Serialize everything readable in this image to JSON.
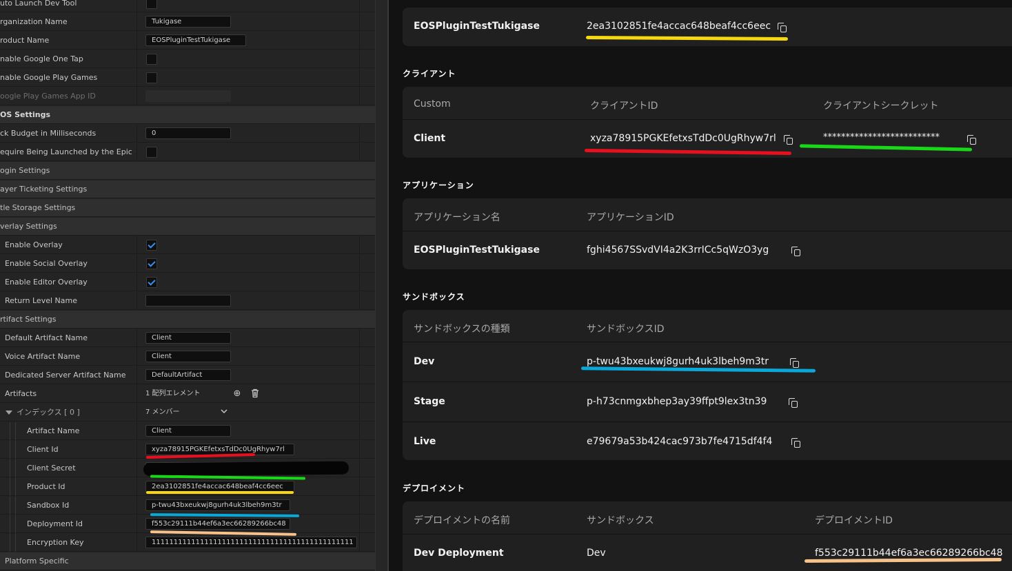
{
  "colors": {
    "red": "#e8101e",
    "green": "#18d818",
    "yellow": "#f6d80e",
    "blue": "#0aa8d8",
    "orange": "#f7c28a"
  },
  "ue": {
    "rows": [
      {
        "label": "uto Launch Dev Tool"
      },
      {
        "label": "rganization Name",
        "value": "Tukigase"
      },
      {
        "label": "roduct Name",
        "value": "EOSPluginTestTukigase"
      },
      {
        "label": "nable Google One Tap"
      },
      {
        "label": "nable Google Play Games"
      },
      {
        "label": "oogle Play Games App ID"
      },
      {
        "label": "OS Settings"
      },
      {
        "label": "ck Budget in Milliseconds",
        "value": "0"
      },
      {
        "label": "equire Being Launched by the Epic Ga..."
      },
      {
        "label": "ogin Settings"
      },
      {
        "label": "ayer Ticketing Settings"
      },
      {
        "label": "tle Storage Settings"
      },
      {
        "label": "verlay Settings"
      },
      {
        "label": "Enable Overlay"
      },
      {
        "label": "Enable Social Overlay"
      },
      {
        "label": "Enable Editor Overlay"
      },
      {
        "label": "Return Level Name",
        "value": ""
      },
      {
        "label": "rtifact Settings"
      },
      {
        "label": "Default Artifact Name",
        "value": "Client"
      },
      {
        "label": "Voice Artifact Name",
        "value": "Client"
      },
      {
        "label": "Dedicated Server Artifact Name",
        "value": "DefaultArtifact"
      },
      {
        "label": "Artifacts",
        "value": "1 配列エレメント"
      },
      {
        "label": "インデックス [ 0 ]",
        "value": "7 メンバー"
      },
      {
        "label": "Artifact Name",
        "value": "Client"
      },
      {
        "label": "Client Id",
        "value": "xyza78915PGKEfetxsTdDc0UgRhyw7rl"
      },
      {
        "label": "Client Secret",
        "value": ""
      },
      {
        "label": "Product Id",
        "value": "2ea3102851fe4accac648beaf4cc6eec"
      },
      {
        "label": "Sandbox Id",
        "value": "p-twu43bxeukwj8gurh4uk3lbeh9m3tr"
      },
      {
        "label": "Deployment Id",
        "value": "f553c29111b44ef6a3ec66289266bc48"
      },
      {
        "label": "Encryption Key",
        "value": "1111111111111111111111111111111111111111111111"
      },
      {
        "label": "Platform Specific"
      }
    ]
  },
  "portal": {
    "product": {
      "name": "EOSPluginTestTukigase",
      "id": "2ea3102851fe4accac648beaf4cc6eec"
    },
    "clients": {
      "title": "クライアント",
      "headers": [
        "Custom",
        "クライアントID",
        "クライアントシークレット"
      ],
      "row": {
        "name": "Client",
        "id": "xyza78915PGKEfetxsTdDc0UgRhyw7rl",
        "secret": "**************************"
      }
    },
    "applications": {
      "title": "アプリケーション",
      "headers": [
        "アプリケーション名",
        "アプリケーションID"
      ],
      "row": {
        "name": "EOSPluginTestTukigase",
        "id": "fghi4567SSvdVI4a2K3rrICc5qWzO3yg"
      }
    },
    "sandboxes": {
      "title": "サンドボックス",
      "headers": [
        "サンドボックスの種類",
        "サンドボックスID"
      ],
      "rows": [
        {
          "type": "Dev",
          "id": "p-twu43bxeukwj8gurh4uk3lbeh9m3tr"
        },
        {
          "type": "Stage",
          "id": "p-h73cnmgxbhep3ay39ffpt9lex3tn39"
        },
        {
          "type": "Live",
          "id": "e79679a53b424cac973b7fe4715df4f4"
        }
      ]
    },
    "deployments": {
      "title": "デプロイメント",
      "headers": [
        "デプロイメントの名前",
        "サンドボックス",
        "デプロイメントID"
      ],
      "row": {
        "name": "Dev Deployment",
        "sandbox": "Dev",
        "id": "f553c29111b44ef6a3ec66289266bc48"
      }
    }
  }
}
